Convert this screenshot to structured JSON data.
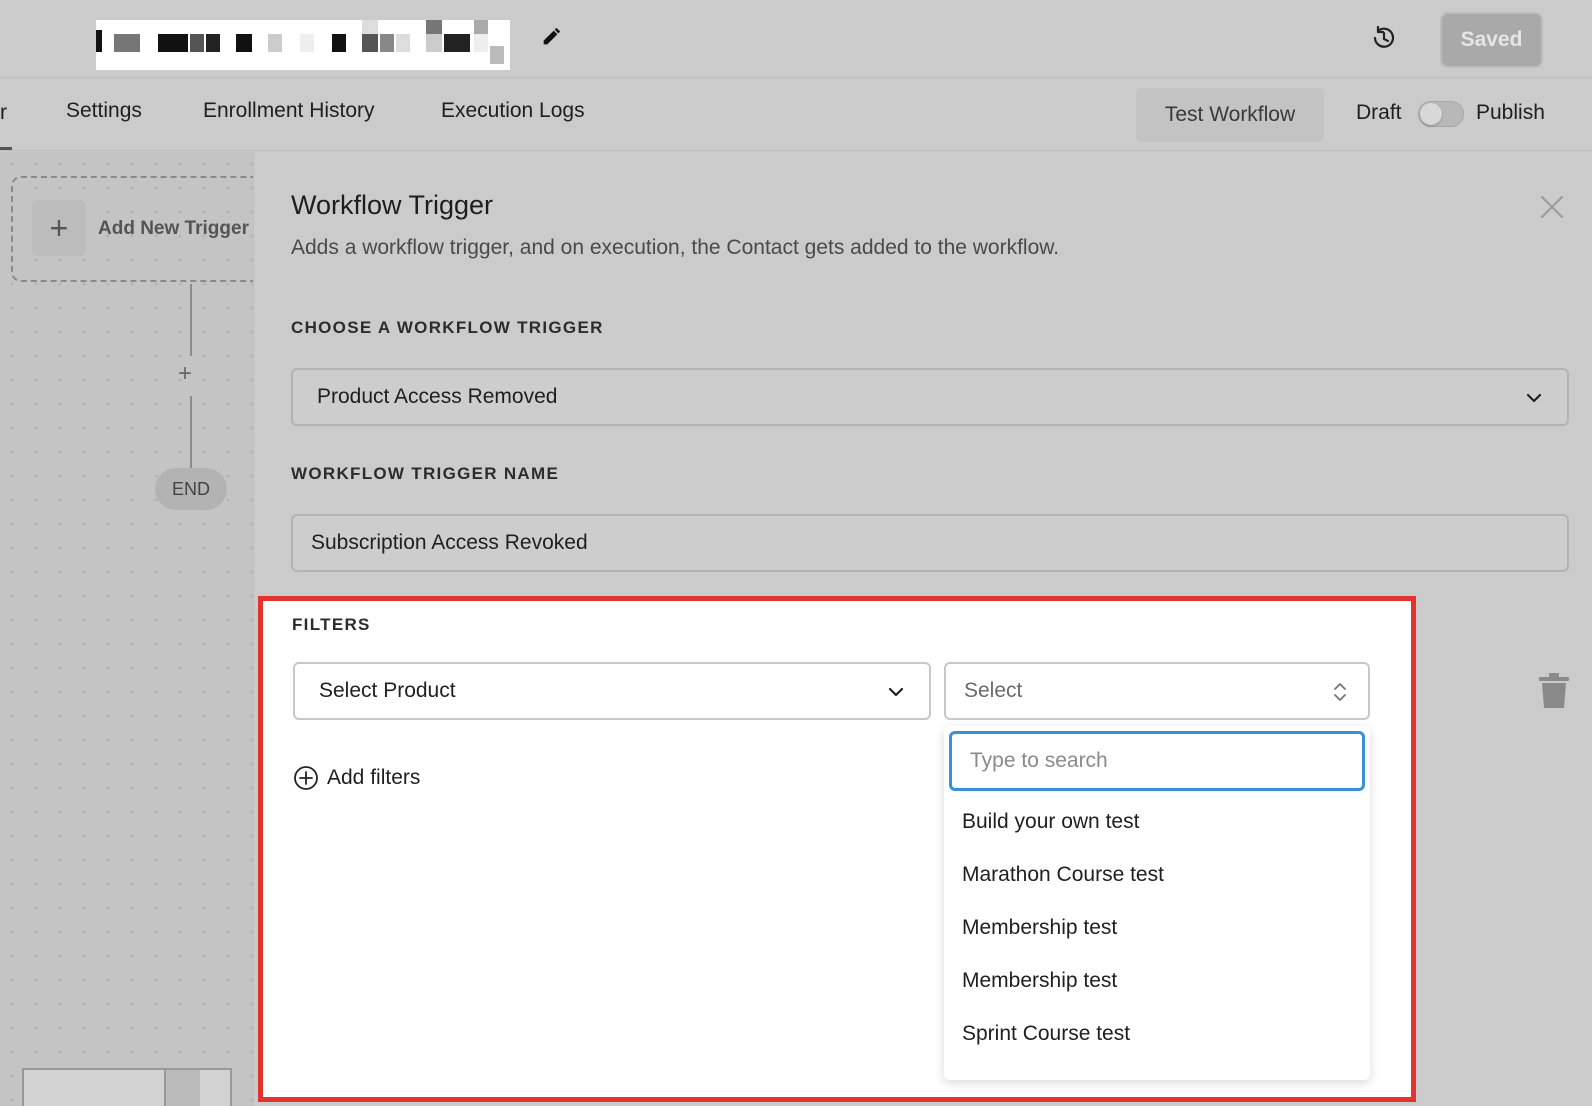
{
  "header": {
    "saved_label": "Saved"
  },
  "tabs": {
    "cut_label": "r",
    "items": [
      {
        "label": "Settings"
      },
      {
        "label": "Enrollment History"
      },
      {
        "label": "Execution Logs"
      }
    ],
    "test_label": "Test Workflow",
    "draft_label": "Draft",
    "publish_label": "Publish"
  },
  "canvas": {
    "trigger_label": "Add New Trigger",
    "plus_glyph": "+",
    "end_label": "END"
  },
  "panel": {
    "title": "Workflow Trigger",
    "subtitle": "Adds a workflow trigger, and on execution, the Contact gets added to the workflow.",
    "choose_label": "CHOOSE A WORKFLOW TRIGGER",
    "trigger_value": "Product Access Removed",
    "name_label": "WORKFLOW TRIGGER NAME",
    "name_value": "Subscription Access Revoked"
  },
  "filters": {
    "label": "FILTERS",
    "product_select": "Select Product",
    "value_select": "Select",
    "add_label": "Add filters",
    "search_placeholder": "Type to search",
    "options": [
      {
        "label": "Build your own test"
      },
      {
        "label": "Marathon Course test"
      },
      {
        "label": "Membership test"
      },
      {
        "label": "Membership test"
      },
      {
        "label": "Sprint Course test"
      }
    ]
  },
  "colors": {
    "highlight": "#e3332d",
    "focus": "#3b8fd4"
  },
  "icons": [
    "edit-icon",
    "history-icon",
    "close-icon",
    "chevron-down-icon",
    "updown-icon",
    "trash-icon",
    "plus-circle-icon"
  ]
}
